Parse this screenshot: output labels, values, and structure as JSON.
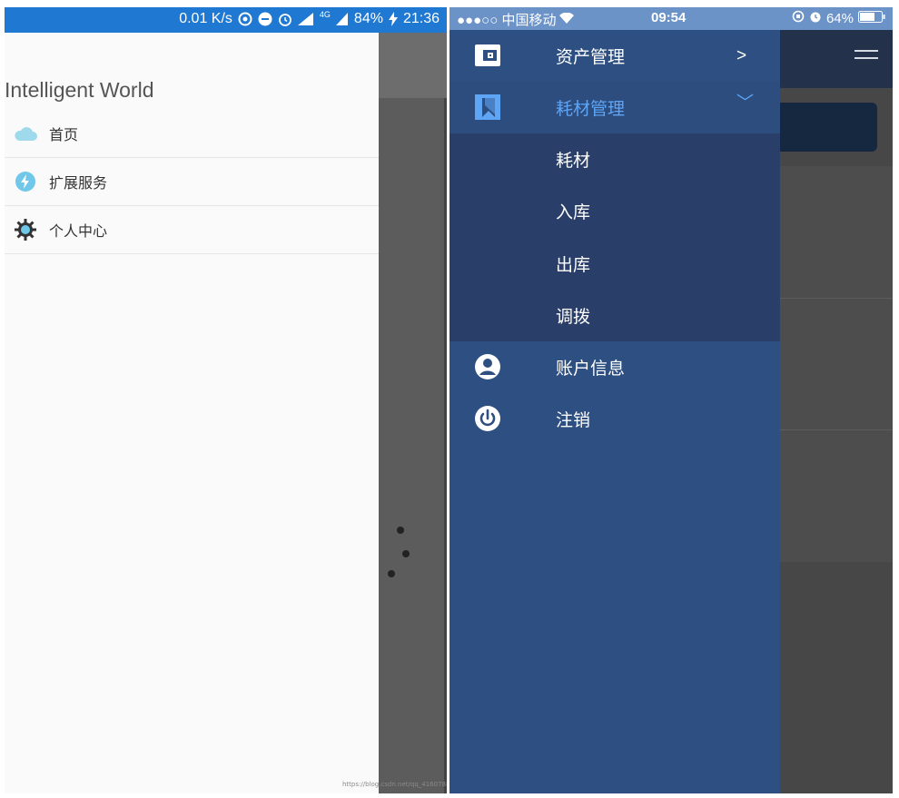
{
  "left": {
    "status": {
      "speed": "0.01 K/s",
      "network": "4G",
      "battery": "84%",
      "time": "21:36"
    },
    "drawer_title": "Intelligent World",
    "items": [
      {
        "label": "首页",
        "icon": "cloud-icon",
        "color": "#9fd9ec"
      },
      {
        "label": "扩展服务",
        "icon": "lightning-icon",
        "color": "#6fc7e9"
      },
      {
        "label": "个人中心",
        "icon": "gear-icon",
        "color": "#333333"
      }
    ],
    "watermark": "https://blog.csdn.net/qq_41607889"
  },
  "right": {
    "status": {
      "carrier": "●●●○○ 中国移动",
      "time": "09:54",
      "battery": "64%"
    },
    "menu": [
      {
        "label": "资产管理",
        "icon": "wallet-icon",
        "arrow": ">"
      },
      {
        "label": "耗材管理",
        "icon": "bookmark-icon",
        "arrow": "﹀",
        "active_color": "#5ea5f5"
      }
    ],
    "submenu": [
      "耗材",
      "入库",
      "出库",
      "调拨"
    ],
    "menu_bottom": [
      {
        "label": "账户信息",
        "icon": "user-circle-icon"
      },
      {
        "label": "注销",
        "icon": "power-icon"
      }
    ],
    "colors": {
      "drawer": "#2e4f81",
      "submenu_bg": "#293e69",
      "status_bar": "#6b93c8"
    }
  }
}
